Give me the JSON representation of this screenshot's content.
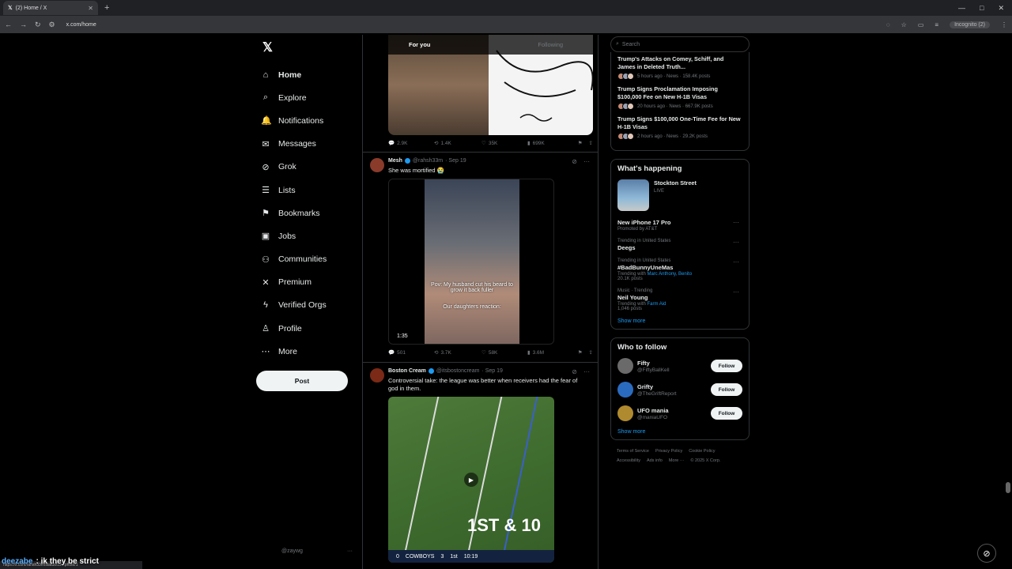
{
  "browser": {
    "tab_title": "(2) Home / X",
    "url": "x.com/home",
    "incognito": "Incognito (2)",
    "status_url": "https://x.com/rahsh33m/status/19...photo/1"
  },
  "nav": {
    "items": [
      {
        "label": "Home",
        "icon": "⌂"
      },
      {
        "label": "Explore",
        "icon": "⌕"
      },
      {
        "label": "Notifications",
        "icon": "🔔"
      },
      {
        "label": "Messages",
        "icon": "✉"
      },
      {
        "label": "Grok",
        "icon": "⊘"
      },
      {
        "label": "Lists",
        "icon": "☰"
      },
      {
        "label": "Bookmarks",
        "icon": "⚑"
      },
      {
        "label": "Jobs",
        "icon": "▣"
      },
      {
        "label": "Communities",
        "icon": "⚇"
      },
      {
        "label": "Premium",
        "icon": "✕"
      },
      {
        "label": "Verified Orgs",
        "icon": "ϟ"
      },
      {
        "label": "Profile",
        "icon": "♙"
      },
      {
        "label": "More",
        "icon": "⋯"
      }
    ],
    "post_label": "Post",
    "account_handle": "@zaywg"
  },
  "feed": {
    "tabs": [
      "For you",
      "Following"
    ],
    "tweet0": {
      "replies": "2.9K",
      "reposts": "1.4K",
      "likes": "35K",
      "views": "699K"
    },
    "tweet1": {
      "name": "Mesh",
      "handle": "@rahsh33m",
      "date": "· Sep 19",
      "text": "She was mortified 😭",
      "caption1": "Pov: My husband cut his beard to grow it back fuller",
      "caption2": "Our daughters reaction:",
      "duration": "1:35",
      "replies": "501",
      "reposts": "3.7K",
      "likes": "58K",
      "views": "3.6M"
    },
    "tweet2": {
      "name": "Boston Cream",
      "handle": "@itsbostoncream",
      "date": "· Sep 19",
      "text": "Controversial take: the league was better when receivers had the fear of god in them.",
      "score": {
        "team1": "0",
        "team2": "COWBOYS",
        "team2_score": "3",
        "quarter": "1st",
        "clock": "10:19",
        "overlay": "1ST & 10"
      }
    }
  },
  "right": {
    "search_placeholder": "Search",
    "news": [
      {
        "title": "Trump's Attacks on Comey, Schiff, and James in Deleted Truth...",
        "meta": "5 hours ago · News · 158.4K posts"
      },
      {
        "title": "Trump Signs Proclamation Imposing $100,000 Fee on New H-1B Visas",
        "meta": "20 hours ago · News · 667.9K posts"
      },
      {
        "title": "Trump Signs $100,000 One-Time Fee for New H-1B Visas",
        "meta": "2 hours ago · News · 29.2K posts"
      }
    ],
    "happening": {
      "title": "What's happening",
      "live_name": "Stockton Street",
      "live_label": "LIVE",
      "trends": [
        {
          "meta": "",
          "name": "New iPhone 17 Pro",
          "with": "Promoted by AT&T",
          "link": "",
          "posts": ""
        },
        {
          "meta": "Trending in United States",
          "name": "Deegs",
          "with": "",
          "link": "",
          "posts": ""
        },
        {
          "meta": "Trending in United States",
          "name": "#BadBunnyUneMas",
          "with": "Trending with",
          "link": "Marc Anthony, Benito",
          "posts": "20.1K posts"
        },
        {
          "meta": "Music · Trending",
          "name": "Neil Young",
          "with": "Trending with",
          "link": "Farm Aid",
          "posts": "1,046 posts"
        }
      ],
      "show_more": "Show more"
    },
    "who_to_follow": {
      "title": "Who to follow",
      "accounts": [
        {
          "name": "Fifty",
          "handle": "@FiftyBallKell",
          "color": "#6a6a6a"
        },
        {
          "name": "Grifty",
          "handle": "@TheGriftReport",
          "color": "#2b6bbf"
        },
        {
          "name": "UFO mania",
          "handle": "@maniaUFO",
          "color": "#b08a2e"
        }
      ],
      "follow_label": "Follow",
      "show_more": "Show more"
    },
    "footer": [
      "Terms of Service",
      "Privacy Policy",
      "Cookie Policy",
      "Accessibility",
      "Ads info",
      "More ···",
      "© 2025 X Corp."
    ]
  },
  "overlay": {
    "chat_user": "deezabe",
    "chat_msg": ": ik they be strict"
  }
}
